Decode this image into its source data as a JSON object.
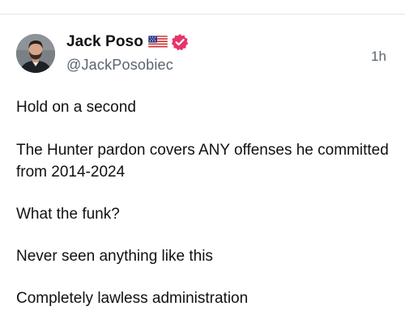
{
  "post": {
    "author": {
      "display_name": "Jack Poso",
      "handle": "@JackPosobiec",
      "flag_icon": "us-flag-icon",
      "verified_icon": "verified-badge-icon",
      "verified_color": "#e8346a"
    },
    "timestamp": "1h",
    "paragraphs": [
      "Hold on a second",
      "The Hunter pardon covers ANY offenses he committed from 2014-2024",
      "What the funk?",
      "Never seen anything like this",
      "Completely lawless administration"
    ]
  }
}
